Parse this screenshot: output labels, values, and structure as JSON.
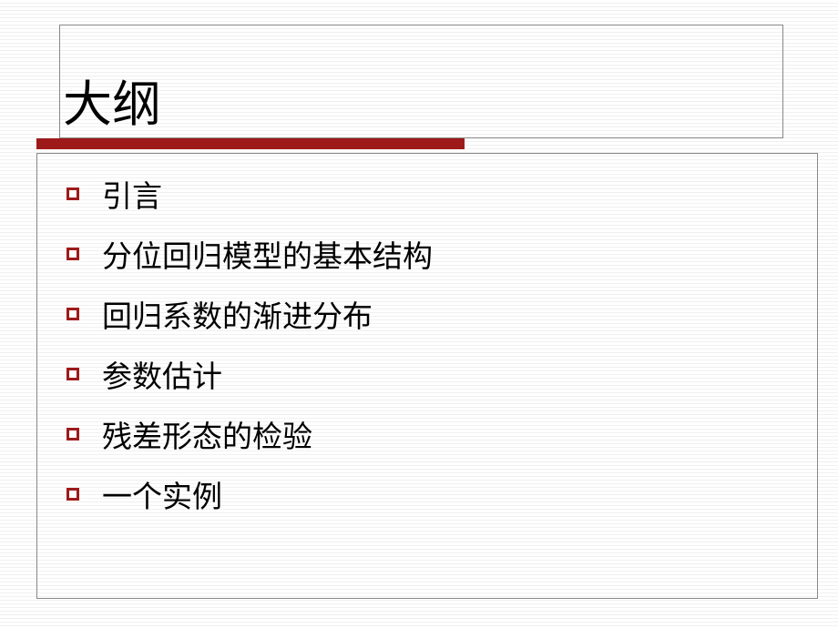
{
  "title": "大纲",
  "bullets": [
    "引言",
    "分位回归模型的基本结构",
    "回归系数的渐进分布",
    "参数估计",
    "残差形态的检验",
    "一个实例"
  ]
}
